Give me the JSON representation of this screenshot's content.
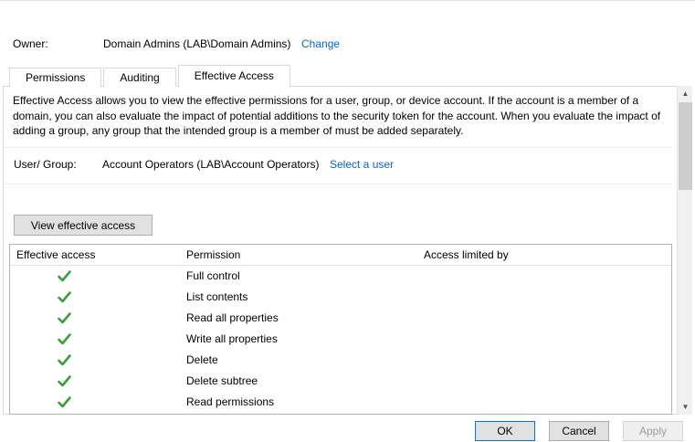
{
  "owner": {
    "label": "Owner:",
    "value": "Domain Admins (LAB\\Domain Admins)",
    "change_link": "Change"
  },
  "tabs": [
    {
      "label": "Permissions",
      "active": false
    },
    {
      "label": "Auditing",
      "active": false
    },
    {
      "label": "Effective Access",
      "active": true
    }
  ],
  "effective_access": {
    "description": "Effective Access allows you to view the effective permissions for a user, group, or device account. If the account is a member of a domain, you can also evaluate the impact of potential additions to the security token for the account. When you evaluate the impact of adding a group, any group that the intended group is a member of must be added separately.",
    "user_group_label": "User/ Group:",
    "user_group_value": "Account Operators (LAB\\Account Operators)",
    "select_user_link": "Select a user",
    "view_button_label": "View effective access"
  },
  "table": {
    "columns": [
      "Effective access",
      "Permission",
      "Access limited by"
    ],
    "rows": [
      {
        "effective": "granted",
        "permission": "Full control",
        "limited_by": ""
      },
      {
        "effective": "granted",
        "permission": "List contents",
        "limited_by": ""
      },
      {
        "effective": "granted",
        "permission": "Read all properties",
        "limited_by": ""
      },
      {
        "effective": "granted",
        "permission": "Write all properties",
        "limited_by": ""
      },
      {
        "effective": "granted",
        "permission": "Delete",
        "limited_by": ""
      },
      {
        "effective": "granted",
        "permission": "Delete subtree",
        "limited_by": ""
      },
      {
        "effective": "granted",
        "permission": "Read permissions",
        "limited_by": ""
      }
    ]
  },
  "scrollbar": {
    "up_glyph": "▲",
    "down_glyph": "▼"
  },
  "footer": {
    "ok_label": "OK",
    "cancel_label": "Cancel",
    "apply_label": "Apply"
  },
  "colors": {
    "link": "#0066cc",
    "check_green": "#3a9e3a"
  }
}
